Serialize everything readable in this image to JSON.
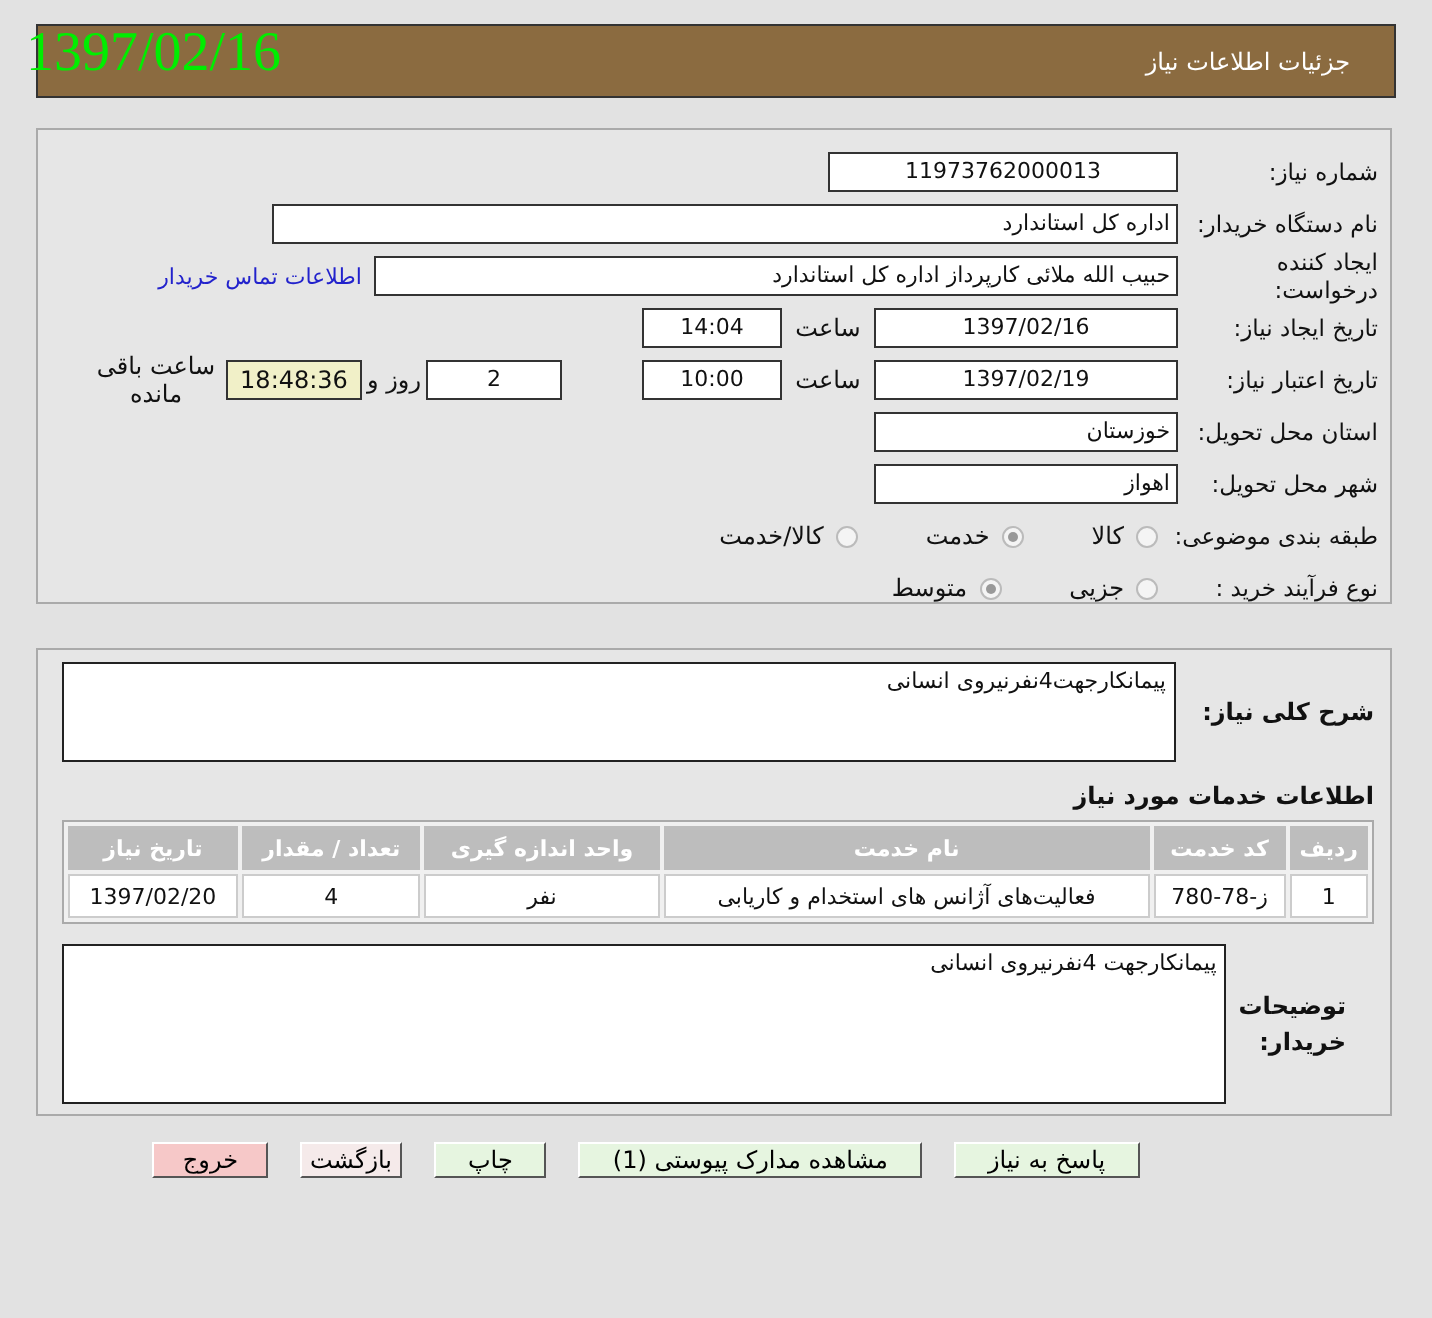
{
  "date_stamp": "1397/02/16",
  "header": {
    "title": "جزئیات اطلاعات نیاز"
  },
  "form": {
    "need_number": {
      "label": "شماره نیاز:",
      "value": "11973762000013"
    },
    "buyer_org": {
      "label": "نام دستگاه خریدار:",
      "value": "اداره کل استاندارد"
    },
    "requester": {
      "label": "ایجاد کننده درخواست:",
      "value": "حبیب الله ملائی کارپرداز اداره کل استاندارد",
      "link": "اطلاعات تماس خریدار"
    },
    "created": {
      "label": "تاریخ ایجاد نیاز:",
      "date": "1397/02/16",
      "time_label": "ساعت",
      "time": "14:04"
    },
    "valid": {
      "label": "تاریخ اعتبار نیاز:",
      "date": "1397/02/19",
      "time_label": "ساعت",
      "time": "10:00",
      "days": "2",
      "days_label": "روز و",
      "remaining": "18:48:36",
      "remaining_label": "ساعت باقی مانده"
    },
    "province": {
      "label": "استان محل تحویل:",
      "value": "خوزستان"
    },
    "city": {
      "label": "شهر محل تحویل:",
      "value": "اهواز"
    },
    "category": {
      "label": "طبقه بندی موضوعی:",
      "options": [
        {
          "label": "کالا",
          "selected": false
        },
        {
          "label": "خدمت",
          "selected": true
        },
        {
          "label": "کالا/خدمت",
          "selected": false
        }
      ]
    },
    "purchase_type": {
      "label": "نوع فرآیند خرید :",
      "options": [
        {
          "label": "جزیی",
          "selected": false
        },
        {
          "label": "متوسط",
          "selected": true
        }
      ]
    }
  },
  "description": {
    "label": "شرح کلی نیاز:",
    "value": "پیمانکارجهت4نفرنیروی انسانی"
  },
  "services": {
    "title": "اطلاعات خدمات مورد نیاز",
    "columns": [
      "ردیف",
      "کد خدمت",
      "نام خدمت",
      "واحد اندازه گیری",
      "تعداد / مقدار",
      "تاریخ نیاز"
    ],
    "rows": [
      [
        "1",
        "ز-78-780",
        "فعالیت‌های آژانس های استخدام و کاریابی",
        "نفر",
        "4",
        "1397/02/20"
      ]
    ]
  },
  "buyer_notes": {
    "label": "توضیحات خریدار:",
    "value": "پیمانکارجهت 4نفرنیروی انسانی"
  },
  "buttons": [
    {
      "label": "پاسخ به نیاز",
      "kind": "normal"
    },
    {
      "label": "مشاهده مدارک پیوستی (1)",
      "kind": "normal"
    },
    {
      "label": "چاپ",
      "kind": "normal"
    },
    {
      "label": "بازگشت",
      "kind": "back"
    },
    {
      "label": "خروج",
      "kind": "exit"
    }
  ]
}
